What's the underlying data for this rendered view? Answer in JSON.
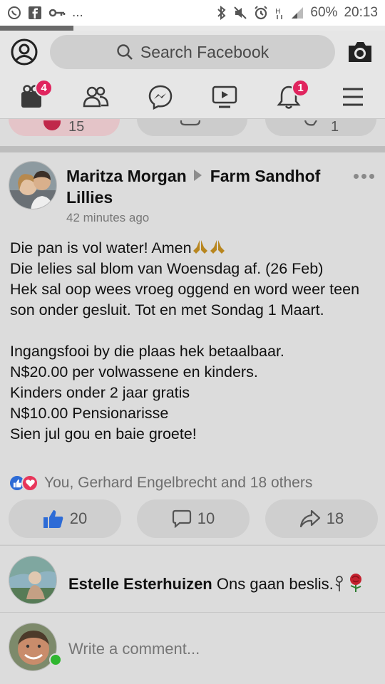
{
  "status_bar": {
    "battery": "60%",
    "time": "20:13",
    "ellipsis": "...",
    "left_icons": [
      "whatsapp-icon",
      "facebook-icon",
      "key-icon"
    ],
    "right_icons": [
      "bluetooth-icon",
      "mute-icon",
      "alarm-icon",
      "data-h-icon",
      "signal-icon"
    ]
  },
  "page_load_progress": 0.19,
  "header": {
    "search_placeholder": "Search Facebook"
  },
  "nav": {
    "items": [
      {
        "icon": "watch-icon",
        "badge": "4"
      },
      {
        "icon": "friends-icon",
        "badge": ""
      },
      {
        "icon": "messenger-icon",
        "badge": ""
      },
      {
        "icon": "video-icon",
        "badge": ""
      },
      {
        "icon": "bell-icon",
        "badge": "1"
      },
      {
        "icon": "menu-icon",
        "badge": ""
      }
    ]
  },
  "prev_post": {
    "like_count": "15",
    "share_count": "1"
  },
  "post": {
    "author": "Maritza Morgan",
    "page": "Farm Sandhof Lillies",
    "time": "42 minutes ago",
    "line1": "Die pan is vol water! Amen",
    "body": "Die lelies sal blom van Woensdag af. (26 Feb)\nHek sal oop wees vroeg oggend en word weer teen son onder gesluit. Tot en met Sondag 1 Maart.\n\nIngangsfooi by die plaas hek betaalbaar.\nN$20.00 per volwassene en kinders.\nKinders onder 2 jaar gratis\nN$10.00 Pensionarisse\nSien jul gou en baie groete!",
    "reactions_text": "You, Gerhard Engelbrecht and 18 others",
    "like_count": "20",
    "comment_count": "10",
    "share_count": "18"
  },
  "comments": [
    {
      "name": "Estelle Esterhuizen",
      "text": "Ons gaan beslis."
    }
  ],
  "composer": {
    "placeholder": "Write a comment..."
  },
  "colors": {
    "badge": "#e0245e",
    "like_blue": "#2d6bd6",
    "love_red": "#e8365a",
    "online_green": "#2fb72f"
  }
}
